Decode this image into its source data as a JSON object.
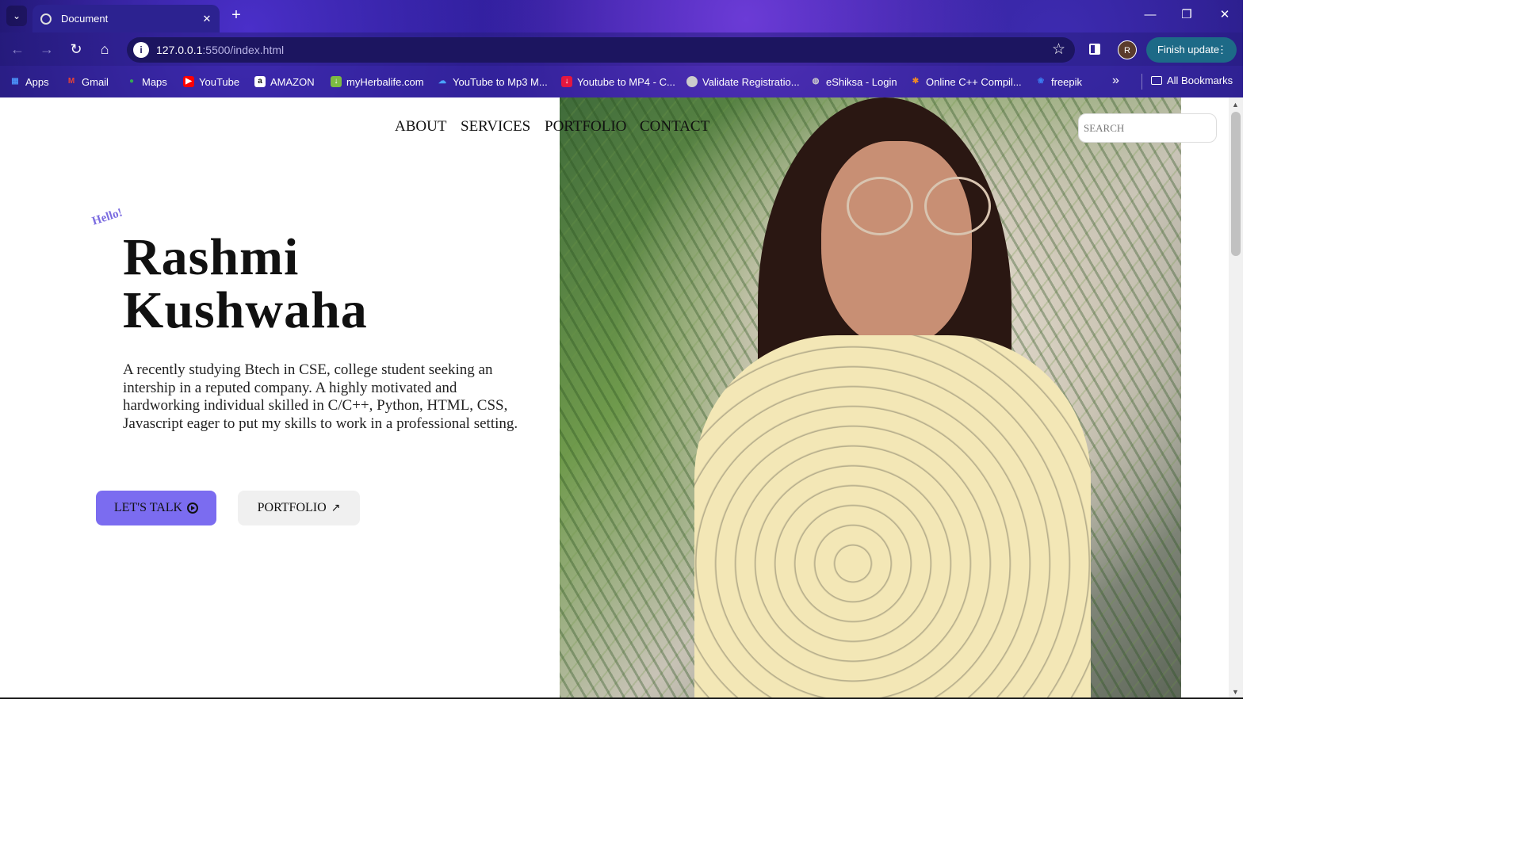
{
  "browser": {
    "tab_title": "Document",
    "url_host": "127.0.0.1",
    "url_rest": ":5500/index.html",
    "finish_update": "Finish update",
    "avatar_letter": "R",
    "all_bookmarks": "All Bookmarks",
    "bookmarks": [
      {
        "label": "Apps",
        "icon": "apps-grid-icon",
        "color": "#4a8ff5"
      },
      {
        "label": "Gmail",
        "icon": "gmail-icon",
        "color": "#ea4335"
      },
      {
        "label": "Maps",
        "icon": "maps-pin-icon",
        "color": "#34a853"
      },
      {
        "label": "YouTube",
        "icon": "youtube-icon",
        "color": "#ff0000"
      },
      {
        "label": "AMAZON",
        "icon": "amazon-icon",
        "color": "#ffffff"
      },
      {
        "label": "myHerbalife.com",
        "icon": "herbalife-icon",
        "color": "#7dbb42"
      },
      {
        "label": "YouTube to Mp3 M...",
        "icon": "cloud-download-icon",
        "color": "#4aa3ff"
      },
      {
        "label": "Youtube to MP4 - C...",
        "icon": "download-icon",
        "color": "#e5173f"
      },
      {
        "label": "Validate Registratio...",
        "icon": "site-icon",
        "color": "#cccccc"
      },
      {
        "label": "eShiksa - Login",
        "icon": "globe-icon",
        "color": "#cccccc"
      },
      {
        "label": "Online C++ Compil...",
        "icon": "gear-icon",
        "color": "#f08a24"
      },
      {
        "label": "freepik",
        "icon": "freepik-icon",
        "color": "#3b7ff5"
      }
    ]
  },
  "page": {
    "nav": [
      "ABOUT",
      "SERVICES",
      "PORTFOLIO",
      "CONTACT"
    ],
    "search_placeholder": "SEARCH",
    "hello": "Hello!",
    "name_line1": "Rashmi",
    "name_line2": "Kushwaha",
    "description": "A recently studying Btech in CSE, college student seeking an intership in a reputed company. A highly motivated and hardworking individual skilled in C/C++, Python, HTML, CSS, Javascript eager to put my skills to work in a professional setting.",
    "btn_talk": "LET'S TALK",
    "btn_portfolio": "PORTFOLIO",
    "accent_color": "#7b6cf0"
  }
}
